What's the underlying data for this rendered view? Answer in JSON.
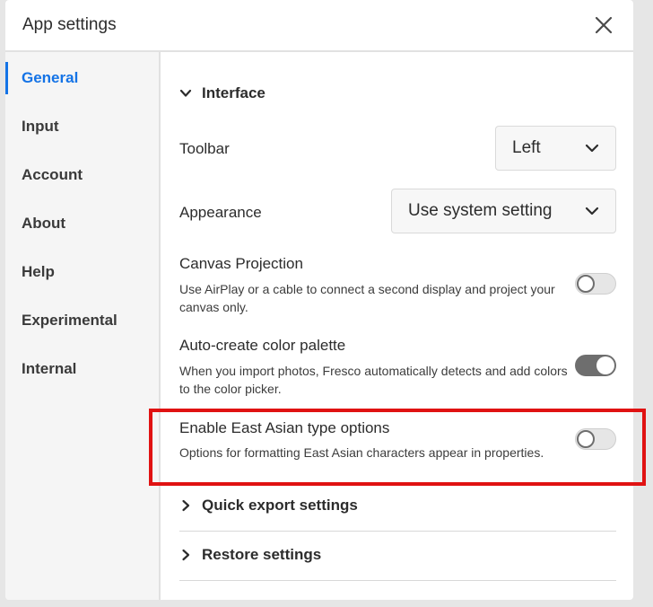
{
  "dialog": {
    "title": "App settings"
  },
  "sidebar": {
    "items": [
      {
        "label": "General",
        "active": true
      },
      {
        "label": "Input",
        "active": false
      },
      {
        "label": "Account",
        "active": false
      },
      {
        "label": "About",
        "active": false
      },
      {
        "label": "Help",
        "active": false
      },
      {
        "label": "Experimental",
        "active": false
      },
      {
        "label": "Internal",
        "active": false
      }
    ]
  },
  "interface": {
    "heading": "Interface",
    "expanded": true,
    "toolbar": {
      "label": "Toolbar",
      "value": "Left"
    },
    "appearance": {
      "label": "Appearance",
      "value": "Use system setting"
    },
    "canvas_projection": {
      "label": "Canvas Projection",
      "description": "Use AirPlay or a cable to connect a second display and project your canvas only.",
      "enabled": false
    },
    "auto_palette": {
      "label": "Auto-create color palette",
      "description": "When you import photos, Fresco automatically detects and add colors to the color picker.",
      "enabled": true
    },
    "east_asian": {
      "label": "Enable East Asian type options",
      "description": "Options for formatting East Asian characters appear in properties.",
      "enabled": false
    }
  },
  "sections": {
    "quick_export": {
      "label": "Quick export settings",
      "expanded": false
    },
    "restore": {
      "label": "Restore settings",
      "expanded": false
    }
  },
  "colors": {
    "accent": "#1473e6",
    "highlight": "#e01212",
    "toggle_on": "#6e6e6e"
  },
  "icons": {
    "close": "close-icon",
    "chevron_down": "chevron-down-icon",
    "chevron_right": "chevron-right-icon"
  }
}
